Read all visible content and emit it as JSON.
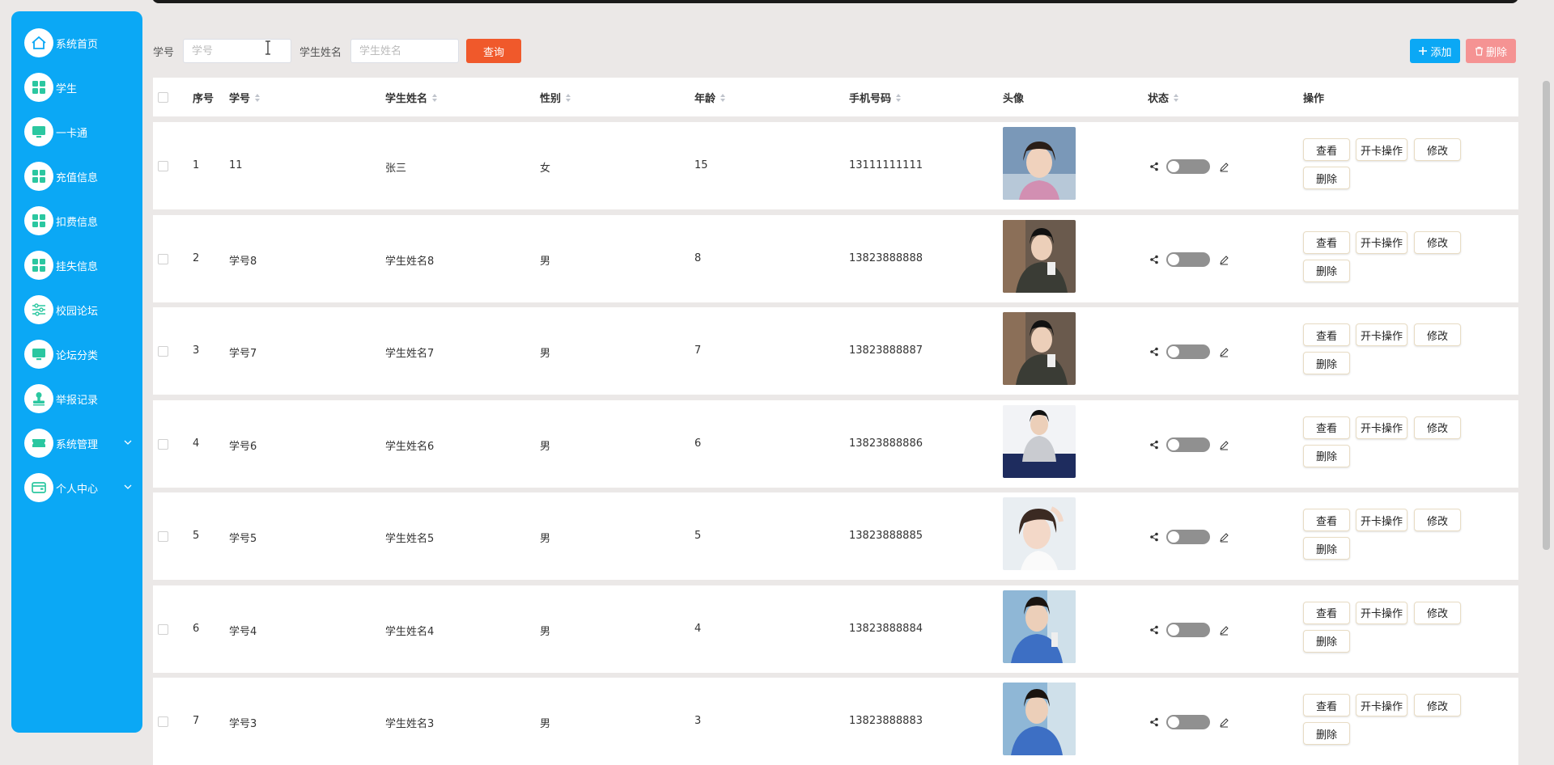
{
  "sidebar": {
    "items": [
      {
        "label": "系统首页",
        "icon": "home-icon",
        "expandable": false
      },
      {
        "label": "学生",
        "icon": "grid-icon",
        "expandable": false
      },
      {
        "label": "一卡通",
        "icon": "monitor-icon",
        "expandable": false
      },
      {
        "label": "充值信息",
        "icon": "grid-icon",
        "expandable": false
      },
      {
        "label": "扣费信息",
        "icon": "grid-icon",
        "expandable": false
      },
      {
        "label": "挂失信息",
        "icon": "grid-icon",
        "expandable": false
      },
      {
        "label": "校园论坛",
        "icon": "sliders-icon",
        "expandable": false
      },
      {
        "label": "论坛分类",
        "icon": "monitor-icon",
        "expandable": false
      },
      {
        "label": "举报记录",
        "icon": "stamp-icon",
        "expandable": false
      },
      {
        "label": "系统管理",
        "icon": "ticket-icon",
        "expandable": true
      },
      {
        "label": "个人中心",
        "icon": "wallet-icon",
        "expandable": true
      }
    ]
  },
  "search": {
    "student_no_label": "学号",
    "student_no_placeholder": "学号",
    "student_name_label": "学生姓名",
    "student_name_placeholder": "学生姓名",
    "query_button": "查询"
  },
  "toolbar": {
    "add_label": "添加",
    "delete_label": "删除"
  },
  "table": {
    "headers": {
      "index": "序号",
      "student_no": "学号",
      "student_name": "学生姓名",
      "gender": "性别",
      "age": "年龄",
      "phone": "手机号码",
      "avatar": "头像",
      "status": "状态",
      "actions": "操作"
    },
    "action_labels": {
      "view": "查看",
      "card": "开卡操作",
      "edit": "修改",
      "delete": "删除"
    },
    "rows": [
      {
        "index": "1",
        "student_no": "11",
        "student_name": "张三",
        "gender": "女",
        "age": "15",
        "phone": "13111111111",
        "status_on": false
      },
      {
        "index": "2",
        "student_no": "学号8",
        "student_name": "学生姓名8",
        "gender": "男",
        "age": "8",
        "phone": "13823888888",
        "status_on": false
      },
      {
        "index": "3",
        "student_no": "学号7",
        "student_name": "学生姓名7",
        "gender": "男",
        "age": "7",
        "phone": "13823888887",
        "status_on": false
      },
      {
        "index": "4",
        "student_no": "学号6",
        "student_name": "学生姓名6",
        "gender": "男",
        "age": "6",
        "phone": "13823888886",
        "status_on": false
      },
      {
        "index": "5",
        "student_no": "学号5",
        "student_name": "学生姓名5",
        "gender": "男",
        "age": "5",
        "phone": "13823888885",
        "status_on": false
      },
      {
        "index": "6",
        "student_no": "学号4",
        "student_name": "学生姓名4",
        "gender": "男",
        "age": "4",
        "phone": "13823888884",
        "status_on": false
      },
      {
        "index": "7",
        "student_no": "学号3",
        "student_name": "学生姓名3",
        "gender": "男",
        "age": "3",
        "phone": "13823888883",
        "status_on": false
      }
    ]
  },
  "colors": {
    "sidebar_bg": "#0ba8f5",
    "query_button": "#f0592b",
    "add_button": "#0ba8f5",
    "delete_button": "#f59393",
    "toggle_off": "#909090"
  }
}
